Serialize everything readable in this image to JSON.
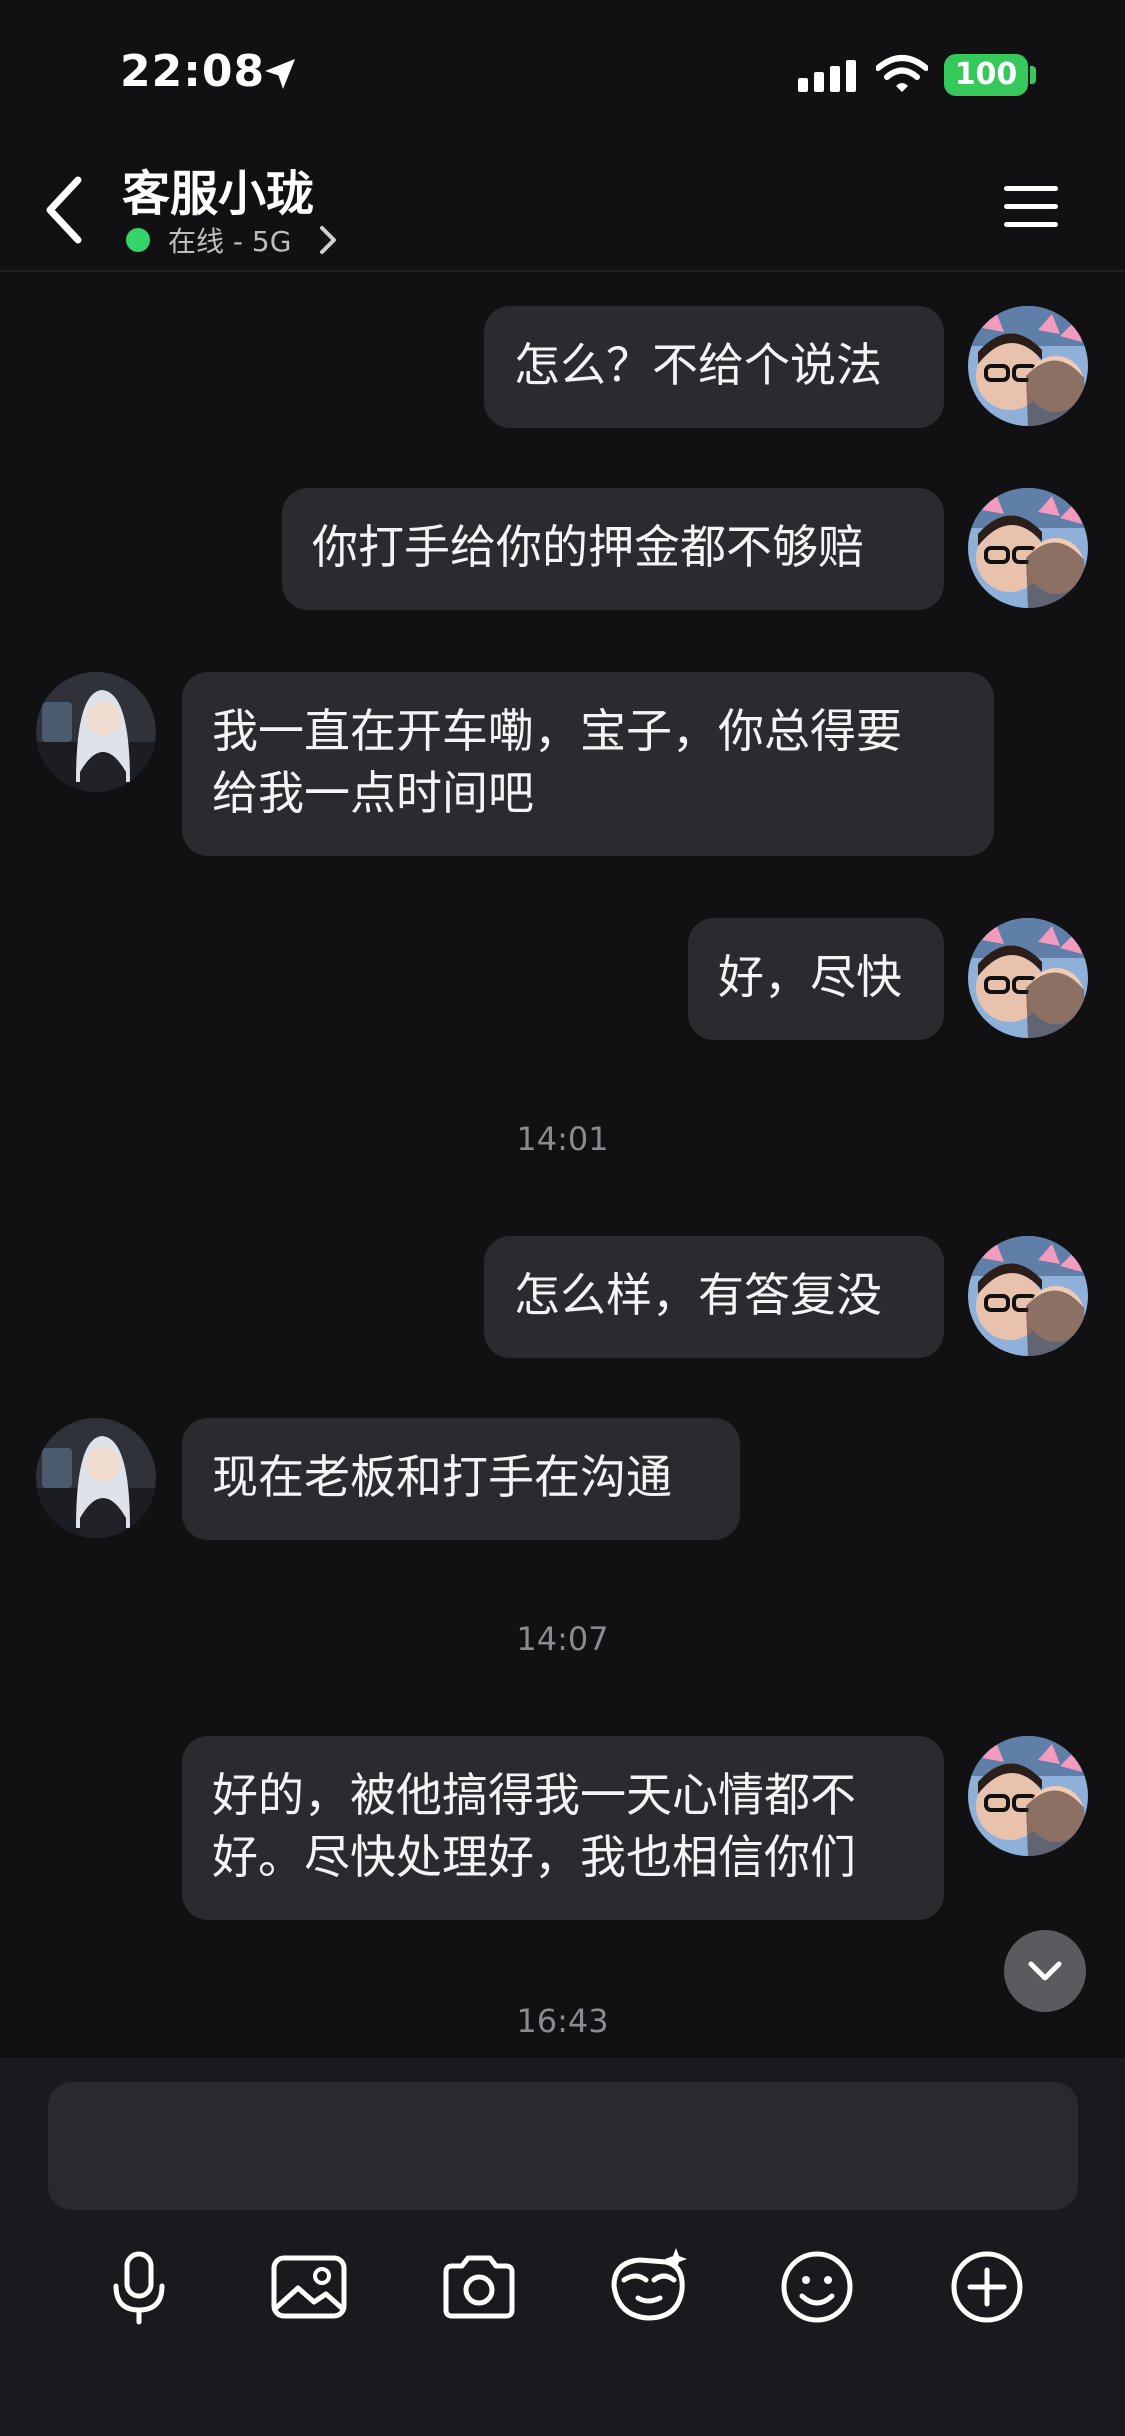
{
  "status_bar": {
    "time": "22:08",
    "battery": "100"
  },
  "header": {
    "title": "客服小珑",
    "presence": "在线 - 5G"
  },
  "messages": [
    {
      "text": "怎么？不给个说法"
    },
    {
      "text": "你打手给你的押金都不够赔"
    },
    {
      "text": "我一直在开车嘞，宝子，你总得要\n给我一点时间吧"
    },
    {
      "text": "好，尽快"
    },
    {
      "text": "怎么样，有答复没"
    },
    {
      "text": "现在老板和打手在沟通"
    },
    {
      "text": "好的，被他搞得我一天心情都不\n好。尽快处理好，我也相信你们"
    }
  ],
  "timestamps": [
    "14:01",
    "14:07",
    "16:43"
  ],
  "composer": {
    "placeholder": ""
  },
  "toolbar": {
    "icons": [
      "microphone-icon",
      "image-icon",
      "camera-icon",
      "sticker-icon",
      "emoji-icon",
      "plus-icon"
    ]
  },
  "colors": {
    "background": "#111114",
    "bubble": "#2a2a2f",
    "online": "#35d36a",
    "battery": "#35c85a"
  }
}
